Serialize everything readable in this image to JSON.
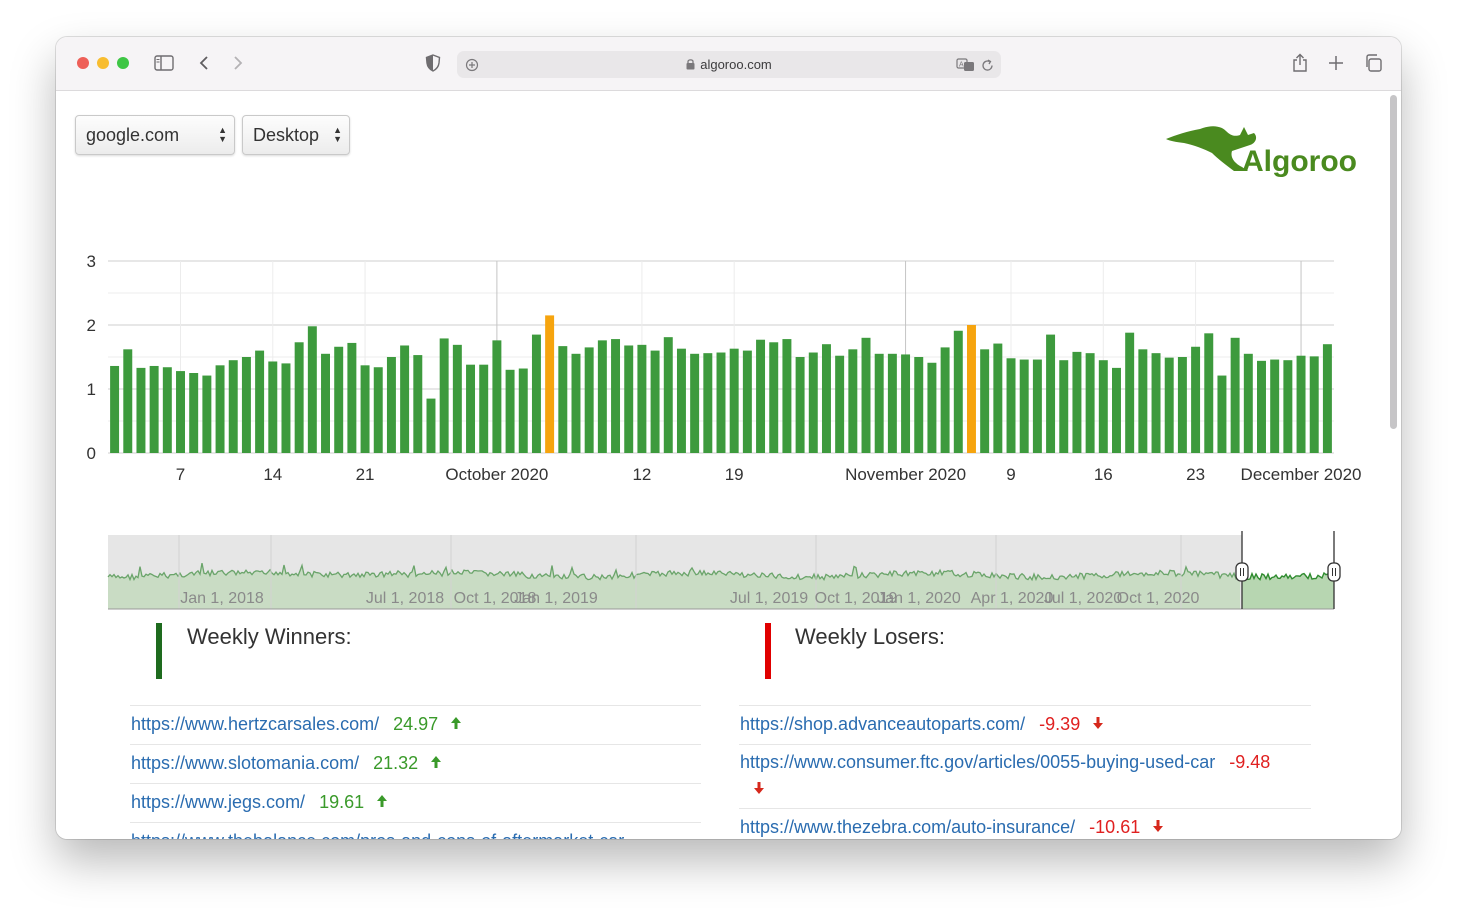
{
  "browser": {
    "url": "algoroo.com",
    "colors": {
      "close": "#ee5f58",
      "minimize": "#f8bd30",
      "maximize": "#3ec645"
    }
  },
  "controls": {
    "domain_select": "google.com",
    "device_select": "Desktop"
  },
  "logo": {
    "text": "Algoroo",
    "color": "#4a8a1f"
  },
  "chart_data": {
    "type": "bar",
    "y_ticks": [
      "0",
      "1",
      "2",
      "3"
    ],
    "ylim": [
      0,
      3
    ],
    "x_tick_labels": [
      {
        "label": "7",
        "index": 5
      },
      {
        "label": "14",
        "index": 12
      },
      {
        "label": "21",
        "index": 19
      },
      {
        "label": "October 2020",
        "index": 29
      },
      {
        "label": "12",
        "index": 40
      },
      {
        "label": "19",
        "index": 47
      },
      {
        "label": "November 2020",
        "index": 60
      },
      {
        "label": "9",
        "index": 68
      },
      {
        "label": "16",
        "index": 75
      },
      {
        "label": "23",
        "index": 82
      },
      {
        "label": "December 2020",
        "index": 90
      }
    ],
    "values": [
      1.36,
      1.62,
      1.33,
      1.36,
      1.34,
      1.28,
      1.25,
      1.21,
      1.37,
      1.45,
      1.5,
      1.6,
      1.43,
      1.4,
      1.73,
      1.98,
      1.55,
      1.66,
      1.72,
      1.37,
      1.34,
      1.5,
      1.68,
      1.53,
      0.85,
      1.79,
      1.69,
      1.38,
      1.38,
      1.76,
      1.3,
      1.32,
      1.85,
      2.15,
      1.67,
      1.55,
      1.65,
      1.76,
      1.78,
      1.68,
      1.69,
      1.6,
      1.81,
      1.63,
      1.55,
      1.56,
      1.57,
      1.63,
      1.6,
      1.77,
      1.73,
      1.78,
      1.5,
      1.57,
      1.7,
      1.52,
      1.62,
      1.8,
      1.55,
      1.55,
      1.54,
      1.5,
      1.41,
      1.65,
      1.91,
      2.0,
      1.62,
      1.71,
      1.48,
      1.46,
      1.46,
      1.85,
      1.45,
      1.58,
      1.56,
      1.45,
      1.33,
      1.88,
      1.62,
      1.56,
      1.49,
      1.5,
      1.66,
      1.87,
      1.21,
      1.8,
      1.55,
      1.44,
      1.46,
      1.45,
      1.52,
      1.51,
      1.7
    ],
    "highlight_indices": [
      33,
      65
    ],
    "colors": {
      "bar": "#3d9a3d",
      "highlight": "#f6a40e"
    }
  },
  "navigator": {
    "labels": [
      "Jan 1, 2018",
      "Jul 1, 2018",
      "Oct 1, 2018",
      "Jan 1, 2019",
      "Jul 1, 2019",
      "Oct 1, 2019",
      "Jan 1, 2020",
      "Apr 1, 2020",
      "Jul 1, 2020",
      "Oct 1, 2020"
    ]
  },
  "winners": {
    "title": "Weekly Winners:",
    "color": "#1e6b1e",
    "items": [
      {
        "url": "https://www.hertzcarsales.com/",
        "value": "24.97"
      },
      {
        "url": "https://www.slotomania.com/",
        "value": "21.32"
      },
      {
        "url": "https://www.jegs.com/",
        "value": "19.61"
      },
      {
        "url": "https://www.thebalance.com/pros-and-cons-of-aftermarket-car",
        "value": ""
      }
    ]
  },
  "losers": {
    "title": "Weekly Losers:",
    "color": "#e00000",
    "items": [
      {
        "url": "https://shop.advanceautoparts.com/",
        "value": "-9.39"
      },
      {
        "url": "https://www.consumer.ftc.gov/articles/0055-buying-used-car",
        "value": "-9.48"
      },
      {
        "url": "https://www.thezebra.com/auto-insurance/",
        "value": "-10.61"
      }
    ]
  },
  "icons": [
    "sidebar-icon",
    "back-icon",
    "forward-icon",
    "shield-icon",
    "site-settings-icon",
    "lock-icon",
    "translate-icon",
    "reload-icon",
    "share-icon",
    "new-tab-icon",
    "tabs-overview-icon",
    "arrow-up-icon",
    "arrow-down-icon",
    "kangaroo-icon"
  ]
}
